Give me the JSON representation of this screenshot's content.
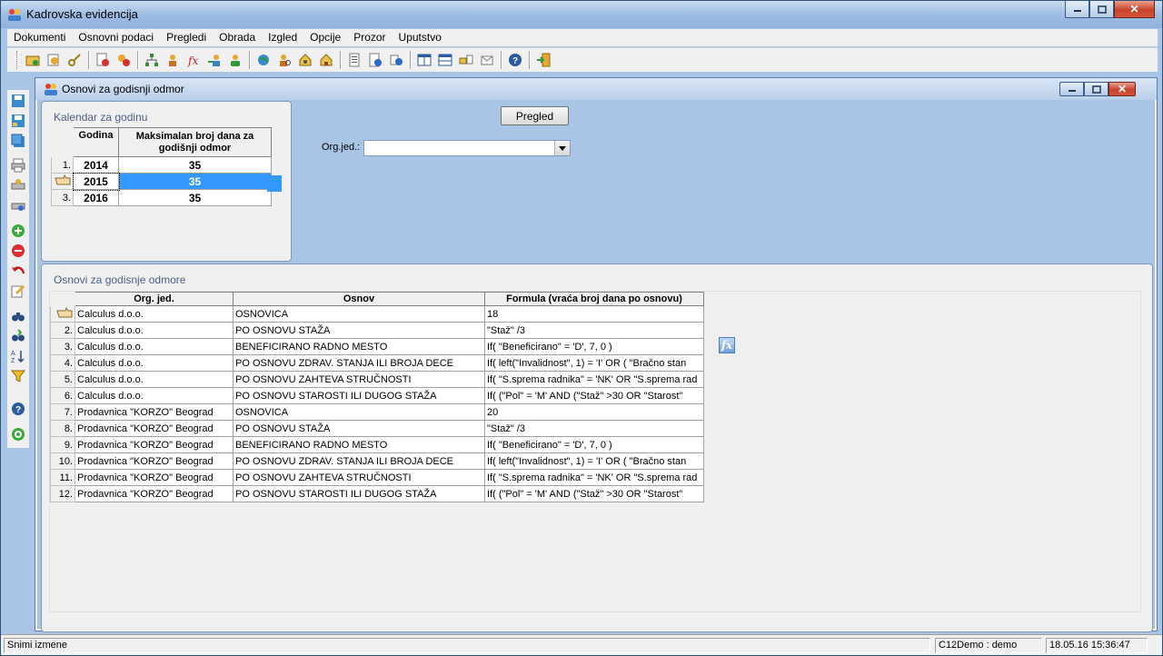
{
  "window": {
    "title": "Kadrovska evidencija",
    "minimize": "–",
    "maximize": "□",
    "close": "✕"
  },
  "menu": [
    "Dokumenti",
    "Osnovni podaci",
    "Pregledi",
    "Obrada",
    "Izgled",
    "Opcije",
    "Prozor",
    "Uputstvo"
  ],
  "toolbar_icons": [
    "folder-open-icon",
    "user-edit-icon",
    "key-icon",
    "delete-doc-icon",
    "block-icon",
    "org-tree-icon",
    "workers-icon",
    "function-icon",
    "user-transfer-icon",
    "user-icon",
    "globe-icon",
    "user-search-icon",
    "house-gear-icon",
    "house-icon",
    "report-icon",
    "info-doc-icon",
    "info-icon",
    "grid-view-icon",
    "table-icon",
    "transfer-icon",
    "mail-icon",
    "help-icon",
    "exit-icon"
  ],
  "side_icons": [
    "save-icon",
    "save-as-icon",
    "save-all-icon",
    "print-icon",
    "print-preview-icon",
    "print-setup-icon",
    "add-record-icon",
    "remove-record-icon",
    "undo-icon",
    "edit-icon",
    "find-icon",
    "find-next-icon",
    "sort-icon",
    "filter-icon",
    "help-icon",
    "refresh-icon"
  ],
  "child_window": {
    "title": "Osnovi za godisnji odmor"
  },
  "calendar": {
    "caption": "Kalendar za godinu",
    "headers": [
      "Godina",
      "Maksimalan broj dana za godišnji odmor"
    ],
    "rows": [
      {
        "num": "1.",
        "year": "2014",
        "days": "35"
      },
      {
        "num": "",
        "year": "2015",
        "days": "35"
      },
      {
        "num": "3.",
        "year": "2016",
        "days": "35"
      }
    ]
  },
  "preview_label": "Pregled",
  "org_label": "Org.jed.:",
  "org_value": "",
  "basis": {
    "caption": "Osnovi za godisnje odmore",
    "headers": [
      "Org. jed.",
      "Osnov",
      "Formula  (vraća broj dana po osnovu)"
    ],
    "rows": [
      {
        "num": "",
        "org": "Calculus d.o.o.",
        "basis": "OSNOVICA",
        "formula": "18"
      },
      {
        "num": "2.",
        "org": "Calculus d.o.o.",
        "basis": "PO OSNOVU STAŽA",
        "formula": "\"Staž\" /3"
      },
      {
        "num": "3.",
        "org": "Calculus d.o.o.",
        "basis": "BENEFICIRANO RADNO MESTO",
        "formula": "If(  \"Beneficirano\" = 'D', 7, 0 )"
      },
      {
        "num": "4.",
        "org": "Calculus d.o.o.",
        "basis": "PO OSNOVU ZDRAV. STANJA ILI BROJA DECE",
        "formula": "If(  left(\"Invalidnost\", 1) = 'I' OR  (  \"Bračno stan"
      },
      {
        "num": "5.",
        "org": "Calculus d.o.o.",
        "basis": "PO OSNOVU ZAHTEVA STRUČNOSTI",
        "formula": "If(  \"S.sprema radnika\" = 'NK' OR   \"S.sprema rad"
      },
      {
        "num": "6.",
        "org": "Calculus d.o.o.",
        "basis": "PO OSNOVU STAROSTI ILI DUGOG STAŽA",
        "formula": "If(   (\"Pol\" = 'M'   AND  (\"Staž\" >30 OR  \"Starost\""
      },
      {
        "num": "7.",
        "org": "Prodavnica \"KORZO\" Beograd",
        "basis": "OSNOVICA",
        "formula": "20"
      },
      {
        "num": "8.",
        "org": "Prodavnica \"KORZO\" Beograd",
        "basis": "PO OSNOVU STAŽA",
        "formula": "\"Staž\" /3"
      },
      {
        "num": "9.",
        "org": "Prodavnica \"KORZO\" Beograd",
        "basis": "BENEFICIRANO RADNO MESTO",
        "formula": "If(  \"Beneficirano\" = 'D', 7, 0 )"
      },
      {
        "num": "10.",
        "org": "Prodavnica \"KORZO\" Beograd",
        "basis": "PO OSNOVU ZDRAV. STANJA ILI BROJA DECE",
        "formula": "If(  left(\"Invalidnost\", 1) = 'I' OR  (  \"Bračno stan"
      },
      {
        "num": "11.",
        "org": "Prodavnica \"KORZO\" Beograd",
        "basis": "PO OSNOVU ZAHTEVA STRUČNOSTI",
        "formula": "If(  \"S.sprema radnika\" = 'NK' OR   \"S.sprema rad"
      },
      {
        "num": "12.",
        "org": "Prodavnica \"KORZO\" Beograd",
        "basis": "PO OSNOVU STAROSTI ILI DUGOG STAŽA",
        "formula": "If(   (\"Pol\" = 'M'   AND  (\"Staž\" >30 OR  \"Starost\""
      }
    ]
  },
  "fx_label": "fx",
  "status": {
    "message": "Snimi izmene",
    "user": "C12Demo : demo",
    "datetime": "18.05.16 15:36:47"
  }
}
